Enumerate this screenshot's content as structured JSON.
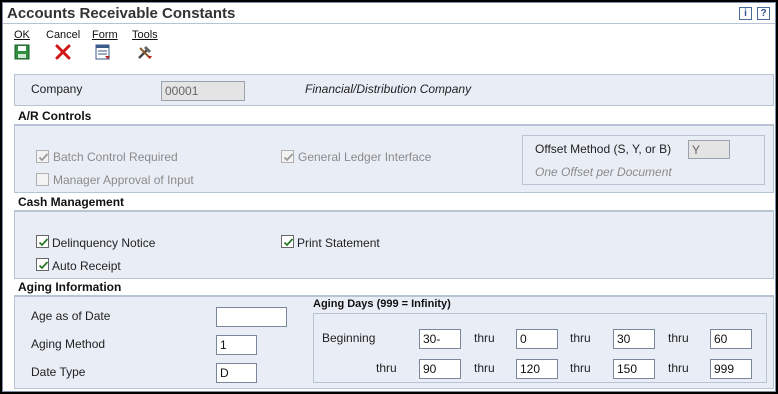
{
  "window": {
    "title": "Accounts Receivable Constants",
    "info_icon": "info-icon",
    "help_icon": "help-icon",
    "help_glyph": "?",
    "info_glyph": "i"
  },
  "toolbar": {
    "ok": {
      "label": "OK",
      "icon": "save-icon"
    },
    "cancel": {
      "label": "Cancel",
      "icon": "close-icon"
    },
    "form": {
      "label": "Form",
      "icon": "form-icon"
    },
    "tools": {
      "label": "Tools",
      "icon": "tools-icon"
    }
  },
  "company": {
    "label": "Company",
    "value": "00001",
    "name": "Financial/Distribution Company"
  },
  "ar_controls": {
    "title": "A/R Controls",
    "batch_control": {
      "label": "Batch Control Required",
      "checked": true,
      "disabled": true
    },
    "manager_approval": {
      "label": "Manager Approval of Input",
      "checked": false,
      "disabled": true
    },
    "gl_interface": {
      "label": "General Ledger Interface",
      "checked": true,
      "disabled": true
    },
    "offset_method": {
      "label": "Offset Method (S, Y, or B)",
      "value": "Y",
      "description": "One Offset per Document"
    }
  },
  "cash_management": {
    "title": "Cash Management",
    "delinquency_notice": {
      "label": "Delinquency Notice",
      "checked": true
    },
    "auto_receipt": {
      "label": "Auto Receipt",
      "checked": true
    },
    "print_statement": {
      "label": "Print Statement",
      "checked": true
    }
  },
  "aging": {
    "title": "Aging Information",
    "age_as_of_date": {
      "label": "Age as of Date",
      "value": ""
    },
    "aging_method": {
      "label": "Aging Method",
      "value": "1"
    },
    "date_type": {
      "label": "Date Type",
      "value": "D"
    },
    "days_title": "Aging Days (999 = Infinity)",
    "beginning_label": "Beginning",
    "thru_label": "thru",
    "row1": [
      "30-",
      "0",
      "30",
      "60"
    ],
    "row2": [
      "90",
      "120",
      "150",
      "999"
    ]
  },
  "colors": {
    "panel_bg": "#e9eef6",
    "border": "#b8c4d4",
    "cancel_red": "#d01818",
    "check_green": "#2a7a2a"
  }
}
